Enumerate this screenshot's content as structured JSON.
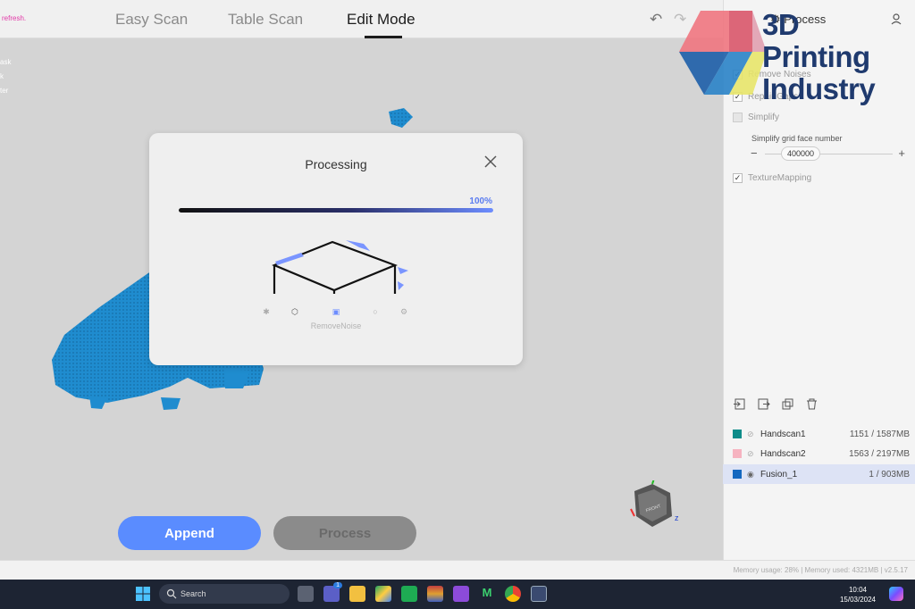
{
  "topbar": {
    "refresh_note": "refresh.",
    "tabs": [
      {
        "label": "Easy Scan"
      },
      {
        "label": "Table Scan"
      },
      {
        "label": "Edit Mode"
      }
    ],
    "active_tab": "Edit Mode"
  },
  "viewport": {
    "side_notes": [
      "ask",
      "k",
      "ter"
    ],
    "append_label": "Append",
    "process_label": "Process",
    "axis_z": "z",
    "cube_face": "FRONT"
  },
  "modal": {
    "title": "Processing",
    "progress_label": "100%",
    "progress_fraction": 1.0,
    "current_step": "RemoveNoise"
  },
  "panel": {
    "logo_lines": [
      "3D",
      "Printing",
      "Industry"
    ],
    "header": "Process",
    "options": [
      {
        "label": "Remove Noises",
        "checked": true
      },
      {
        "label": "Repair Gaps",
        "checked": true
      },
      {
        "label": "Simplify",
        "checked": false
      },
      {
        "label": "TextureMapping",
        "checked": true
      }
    ],
    "simplify_label": "Simplify grid face number",
    "simplify_value": "400000",
    "minus": "−",
    "plus": "+",
    "items": [
      {
        "name": "Handscan1",
        "size": "1151 / 1587MB",
        "color": "#0e8c8a"
      },
      {
        "name": "Handscan2",
        "size": "1563 / 2197MB",
        "color": "#f6b3c0"
      },
      {
        "name": "Fusion_1",
        "size": "1 / 903MB",
        "color": "#1468c0"
      }
    ]
  },
  "statusbar": {
    "memory": "Memory usage: 28% | Memory used: 4321MB | v2.5.17"
  },
  "taskbar": {
    "search_placeholder": "Search",
    "time": "10:04",
    "date": "15/03/2024",
    "teams_badge": "1"
  },
  "colors": {
    "accent": "#5a8cff",
    "scan_blue": "#1f8ccf",
    "progress_end": "#6d8dff"
  }
}
